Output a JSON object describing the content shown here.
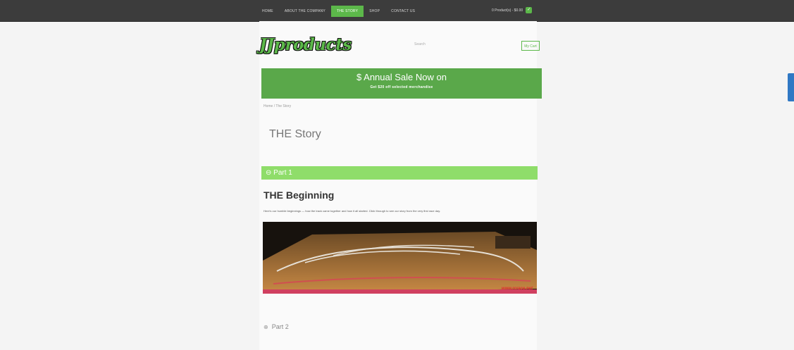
{
  "topbar": {
    "nav": [
      {
        "label": "Home",
        "active": false
      },
      {
        "label": "About the company",
        "active": false
      },
      {
        "label": "The Story",
        "active": true
      },
      {
        "label": "Shop",
        "active": false
      },
      {
        "label": "Contact Us",
        "active": false
      }
    ],
    "cart_label": "0 Product(s) - $0.00",
    "cart_icon": "cart-icon"
  },
  "header": {
    "logo_text": "JJproducts",
    "search_placeholder": "Search",
    "cart_button": "My Cart"
  },
  "banner": {
    "title": "$ Annual Sale Now on",
    "subtitle": "Get $20 off selected merchandise"
  },
  "breadcrumb": "Home / The Story",
  "page_title": "THE Story",
  "accordion": {
    "part1_label": "Part 1",
    "part1_icon": "minus-icon",
    "section_title": "THE Beginning",
    "section_text": "Here's our humble beginnings — how the track came together and how it all started. Click through to see our story from the very first race day.",
    "photo_credit": "www.rcrace.net",
    "part2_label": "Part 2",
    "part2_icon": "plus-icon"
  },
  "colors": {
    "accent": "#5cb84a",
    "topbar": "#3c3c3c",
    "banner": "#5aa84a",
    "accordion": "#8fdd6a",
    "side_tab": "#2f78c4"
  }
}
